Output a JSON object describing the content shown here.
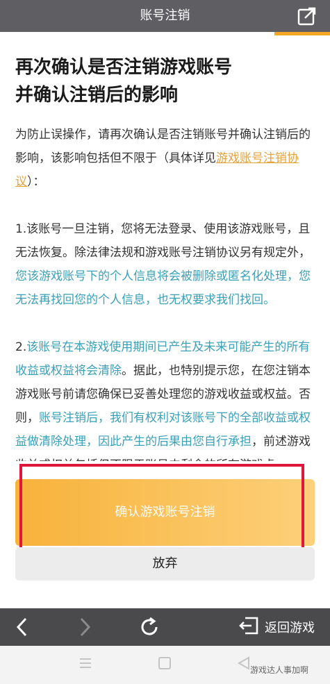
{
  "header": {
    "title": "账号注销",
    "share_icon": "share-icon",
    "accent_color": "#f5a623"
  },
  "content": {
    "heading_line1": "再次确认是否注销游戏账号",
    "heading_line2": "并确认注销后的影响",
    "intro_a": "为防止误操作，请再次确认是否注销账号并确认注销后的影响，该影响包括但不限于（具体详见",
    "intro_link": "游戏账号注销协议",
    "intro_b": "）：",
    "item1_a": "1.该账号一旦注销，您将无法登录、使用该游戏账号，且无法恢复。除法律法规和游戏账号注销协议另有规定外，",
    "item1_hl": "您该游戏账号下的个人信息将会被删除或匿名化处理，您无法再找回您的个人信息，也无权要求我们找回。",
    "item2_a": "2.",
    "item2_hl1": "该账号在本游戏使用期间已产生及未来可能产生的所有收益或权益将会清除",
    "item2_b": "。据此，也特别提示您，在您注销本游戏账号前请您确保已妥善处理您的游戏收益或权益。否则，",
    "item2_hl2": "账号注销后，我们有权利对该账号下的全部收益或权益做清除处理，因此产生的后果由您自行承担",
    "item2_c": "，前述游戏收益或权益包括但不限于账号内剩余的所有游戏虚"
  },
  "actions": {
    "confirm_label": "确认游戏账号注销",
    "cancel_label": "放弃",
    "highlight_color": "#e0163b"
  },
  "navbar": {
    "back_icon": "chevron-left-icon",
    "forward_icon": "chevron-right-icon",
    "refresh_icon": "refresh-icon",
    "back_game_icon": "exit-icon",
    "back_game_label": "返回游戏"
  },
  "system": {
    "menu_icon": "menu-icon",
    "home_icon": "home-icon",
    "back_icon": "triangle-back-icon",
    "watermark": "游戏达人事加啊"
  }
}
